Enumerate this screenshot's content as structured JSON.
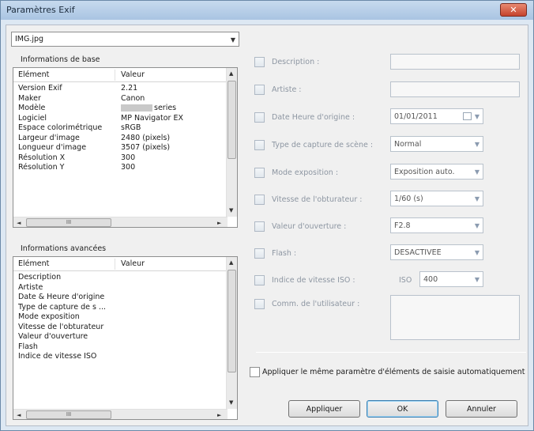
{
  "window": {
    "title": "Paramètres Exif",
    "close_label": "✕"
  },
  "file_select": {
    "value": "IMG.jpg"
  },
  "basic": {
    "label": "Informations de base",
    "columns": [
      "Elément",
      "Valeur"
    ],
    "rows": [
      {
        "element": "Version Exif",
        "value": "2.21"
      },
      {
        "element": "Maker",
        "value": "Canon"
      },
      {
        "element": "Modèle",
        "value": "series"
      },
      {
        "element": "Logiciel",
        "value": "MP Navigator EX"
      },
      {
        "element": "Espace colorimétrique",
        "value": "sRGB"
      },
      {
        "element": "Largeur d'image",
        "value": "2480 (pixels)"
      },
      {
        "element": "Longueur d'image",
        "value": "3507 (pixels)"
      },
      {
        "element": "Résolution X",
        "value": "300"
      },
      {
        "element": "Résolution Y",
        "value": "300"
      }
    ]
  },
  "advanced": {
    "label": "Informations avancées",
    "columns": [
      "Elément",
      "Valeur"
    ],
    "rows": [
      {
        "element": "Description",
        "value": ""
      },
      {
        "element": "Artiste",
        "value": ""
      },
      {
        "element": "Date & Heure d'origine",
        "value": ""
      },
      {
        "element": "Type de capture de s ...",
        "value": ""
      },
      {
        "element": "Mode exposition",
        "value": ""
      },
      {
        "element": "Vitesse de l'obturateur",
        "value": ""
      },
      {
        "element": "Valeur d'ouverture",
        "value": ""
      },
      {
        "element": "Flash",
        "value": ""
      },
      {
        "element": "Indice de vitesse ISO",
        "value": ""
      }
    ]
  },
  "fields": {
    "description": {
      "label": "Description :",
      "value": ""
    },
    "artist": {
      "label": "Artiste :",
      "value": ""
    },
    "datetime": {
      "label": "Date Heure d'origine :",
      "value": "01/01/2011"
    },
    "scene": {
      "label": "Type de capture de scène :",
      "value": "Normal"
    },
    "exposure": {
      "label": "Mode exposition :",
      "value": "Exposition auto."
    },
    "shutter": {
      "label": "Vitesse de l'obturateur :",
      "value": "1/60 (s)"
    },
    "aperture": {
      "label": "Valeur d'ouverture :",
      "value": "F2.8"
    },
    "flash": {
      "label": "Flash :",
      "value": "DESACTIVEE"
    },
    "iso": {
      "label": "Indice de vitesse ISO :",
      "prefix": "ISO",
      "value": "400"
    },
    "comment": {
      "label": "Comm. de l'utilisateur :",
      "value": ""
    }
  },
  "apply_auto": {
    "label": "Appliquer le même paramètre d'éléments de saisie automatiquement",
    "checked": false
  },
  "buttons": {
    "apply": "Appliquer",
    "ok": "OK",
    "cancel": "Annuler"
  },
  "scroll_glyphs": {
    "up": "▲",
    "down": "▼",
    "left": "◄",
    "right": "►",
    "grip": "III"
  }
}
